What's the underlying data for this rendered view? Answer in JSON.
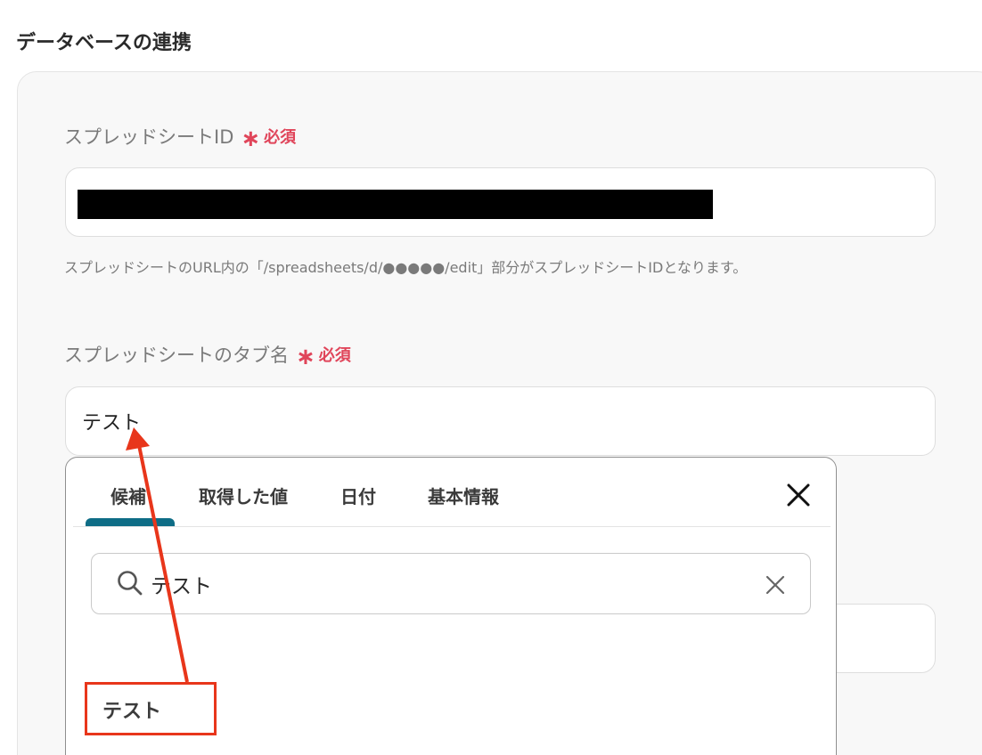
{
  "section": {
    "title": "データベースの連携"
  },
  "fields": {
    "spreadsheet_id": {
      "label": "スプレッドシートID",
      "required_mark": "∗",
      "required_text": "必須",
      "help": "スプレッドシートのURL内の「/spreadsheets/d/●●●●●/edit」部分がスプレッドシートIDとなります。"
    },
    "tab_name": {
      "label": "スプレッドシートのタブ名",
      "required_mark": "∗",
      "required_text": "必須",
      "value": "テスト"
    }
  },
  "popover": {
    "tabs": [
      {
        "label": "候補",
        "active": true
      },
      {
        "label": "取得した値",
        "active": false
      },
      {
        "label": "日付",
        "active": false
      },
      {
        "label": "基本情報",
        "active": false
      }
    ],
    "search": {
      "value": "テスト"
    },
    "suggestions": [
      {
        "label": "テスト"
      }
    ]
  },
  "colors": {
    "required": "#e0455a",
    "tab_indicator": "#0e6d86",
    "annotation": "#e8361b"
  },
  "icons": {
    "close": "close-icon",
    "search": "search-icon",
    "clear": "clear-icon"
  }
}
